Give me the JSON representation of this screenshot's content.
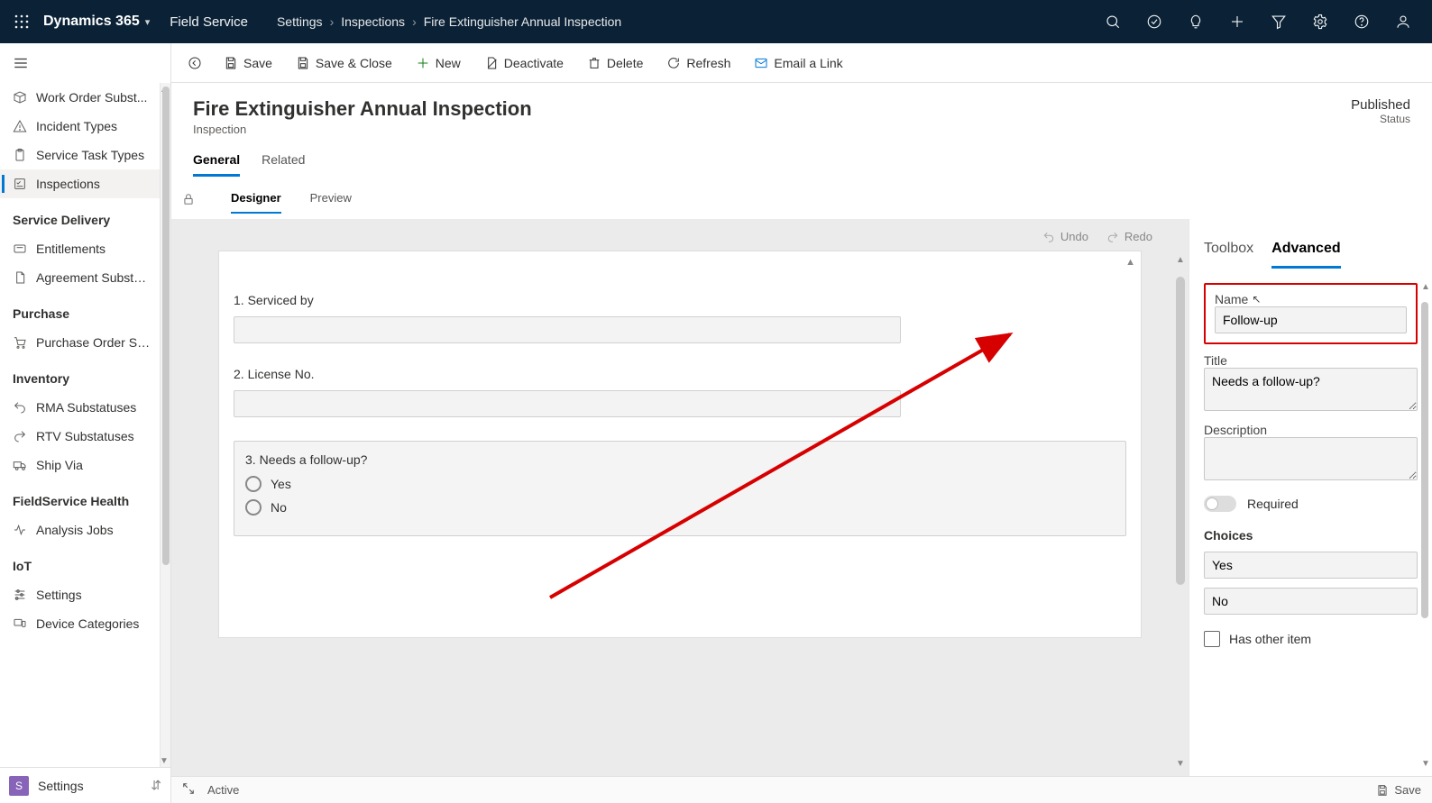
{
  "brand": "Dynamics 365",
  "area": "Field Service",
  "breadcrumb": [
    "Settings",
    "Inspections",
    "Fire Extinguisher Annual Inspection"
  ],
  "topbar_icons": [
    "search-icon",
    "task-icon",
    "lightbulb-icon",
    "add-icon",
    "filter-icon",
    "settings-icon",
    "help-icon",
    "user-icon"
  ],
  "sidenav": {
    "groups": [
      {
        "title": null,
        "items": [
          {
            "icon": "box",
            "label": "Work Order Subst..."
          },
          {
            "icon": "warning",
            "label": "Incident Types"
          },
          {
            "icon": "clipboard",
            "label": "Service Task Types"
          },
          {
            "icon": "checklist",
            "label": "Inspections",
            "active": true
          }
        ]
      },
      {
        "title": "Service Delivery",
        "items": [
          {
            "icon": "ticket",
            "label": "Entitlements"
          },
          {
            "icon": "doc",
            "label": "Agreement Substa..."
          }
        ]
      },
      {
        "title": "Purchase",
        "items": [
          {
            "icon": "cart",
            "label": "Purchase Order Su..."
          }
        ]
      },
      {
        "title": "Inventory",
        "items": [
          {
            "icon": "return",
            "label": "RMA Substatuses"
          },
          {
            "icon": "returnv",
            "label": "RTV Substatuses"
          },
          {
            "icon": "truck",
            "label": "Ship Via"
          }
        ]
      },
      {
        "title": "FieldService Health",
        "items": [
          {
            "icon": "pulse",
            "label": "Analysis Jobs"
          }
        ]
      },
      {
        "title": "IoT",
        "items": [
          {
            "icon": "sliders",
            "label": "Settings"
          },
          {
            "icon": "devices",
            "label": "Device Categories"
          }
        ]
      }
    ],
    "footer_badge": "S",
    "footer_label": "Settings"
  },
  "cmdbar": {
    "back": "←",
    "buttons": [
      {
        "id": "save",
        "label": "Save",
        "icon": "save"
      },
      {
        "id": "save_close",
        "label": "Save & Close",
        "icon": "save"
      },
      {
        "id": "new",
        "label": "New",
        "icon": "plus",
        "color": "green"
      },
      {
        "id": "deactivate",
        "label": "Deactivate",
        "icon": "deactivate"
      },
      {
        "id": "delete",
        "label": "Delete",
        "icon": "trash"
      },
      {
        "id": "refresh",
        "label": "Refresh",
        "icon": "refresh"
      },
      {
        "id": "email",
        "label": "Email a Link",
        "icon": "mail",
        "color": "mail"
      }
    ]
  },
  "header": {
    "title": "Fire Extinguisher Annual Inspection",
    "subtitle": "Inspection",
    "status_value": "Published",
    "status_label": "Status"
  },
  "tabs": [
    "General",
    "Related"
  ],
  "active_tab": "General",
  "subtabs": [
    "Designer",
    "Preview"
  ],
  "active_subtab": "Designer",
  "undo_label": "Undo",
  "redo_label": "Redo",
  "questions": [
    {
      "num": "1.",
      "label": "Serviced by",
      "type": "text"
    },
    {
      "num": "2.",
      "label": "License No.",
      "type": "text"
    },
    {
      "num": "3.",
      "label": "Needs a follow-up?",
      "type": "radio",
      "options": [
        "Yes",
        "No"
      ],
      "selected": true
    }
  ],
  "properties": {
    "tabs": [
      "Toolbox",
      "Advanced"
    ],
    "active": "Advanced",
    "name_label": "Name",
    "name_value": "Follow-up",
    "title_label": "Title",
    "title_value": "Needs a follow-up?",
    "description_label": "Description",
    "description_value": "",
    "required_label": "Required",
    "required": false,
    "choices_label": "Choices",
    "choices": [
      "Yes",
      "No"
    ],
    "has_other_label": "Has other item",
    "has_other": false
  },
  "bottom": {
    "state": "Active",
    "save": "Save"
  }
}
